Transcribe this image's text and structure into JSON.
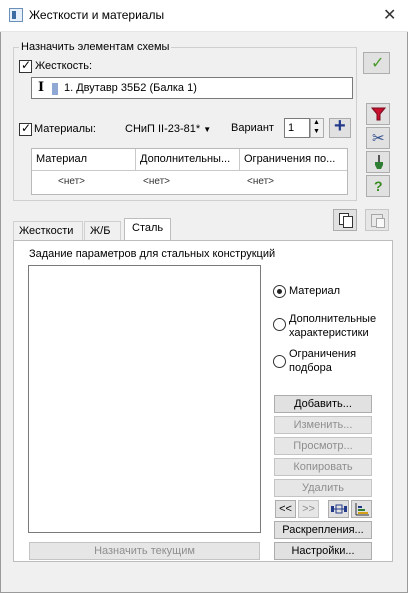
{
  "window": {
    "title": "Жесткости и материалы",
    "close_glyph": "✕"
  },
  "assign_group": {
    "label": "Назначить элементам схемы",
    "stiffness": {
      "checkbox_label": "Жесткость:",
      "checked": true,
      "value": "1. Двутавр 35Б2 (Балка 1)",
      "type_glyph": "I"
    },
    "materials": {
      "checkbox_label": "Материалы:",
      "checked": true,
      "standard": "СНиП II-23-81*",
      "variant_label": "Вариант",
      "variant_value": "1"
    },
    "grid": {
      "columns": [
        "Материал",
        "Дополнительны...",
        "Ограничения по..."
      ],
      "row": [
        "<нет>",
        "<нет>",
        "<нет>"
      ]
    }
  },
  "tabs": [
    {
      "label": "Жесткости",
      "active": false
    },
    {
      "label": "Ж/Б",
      "active": false
    },
    {
      "label": "Сталь",
      "active": true
    }
  ],
  "steel_panel": {
    "caption": "Задание параметров для стальных конструкций",
    "radios": [
      {
        "label": "Материал",
        "selected": true
      },
      {
        "label": "Дополнительные характеристики",
        "selected": false
      },
      {
        "label": "Ограничения подбора",
        "selected": false
      }
    ],
    "buttons": {
      "add": "Добавить...",
      "edit": "Изменить...",
      "view": "Просмотр...",
      "copy": "Копировать",
      "delete": "Удалить",
      "prev": "<<",
      "next": ">>",
      "bracing": "Раскрепления...",
      "settings": "Настройки...",
      "assign_current": "Назначить текущим"
    }
  },
  "icons": [
    "apply-check-icon",
    "filter-icon",
    "scissors-icon",
    "brush-icon",
    "help-icon",
    "copy-icon",
    "paste-icon",
    "plus-icon"
  ],
  "colors": {
    "apply_check": "#4a9a2a",
    "filter": "#c8102e",
    "plus": "#233a8a",
    "help": "#3a8a22"
  }
}
